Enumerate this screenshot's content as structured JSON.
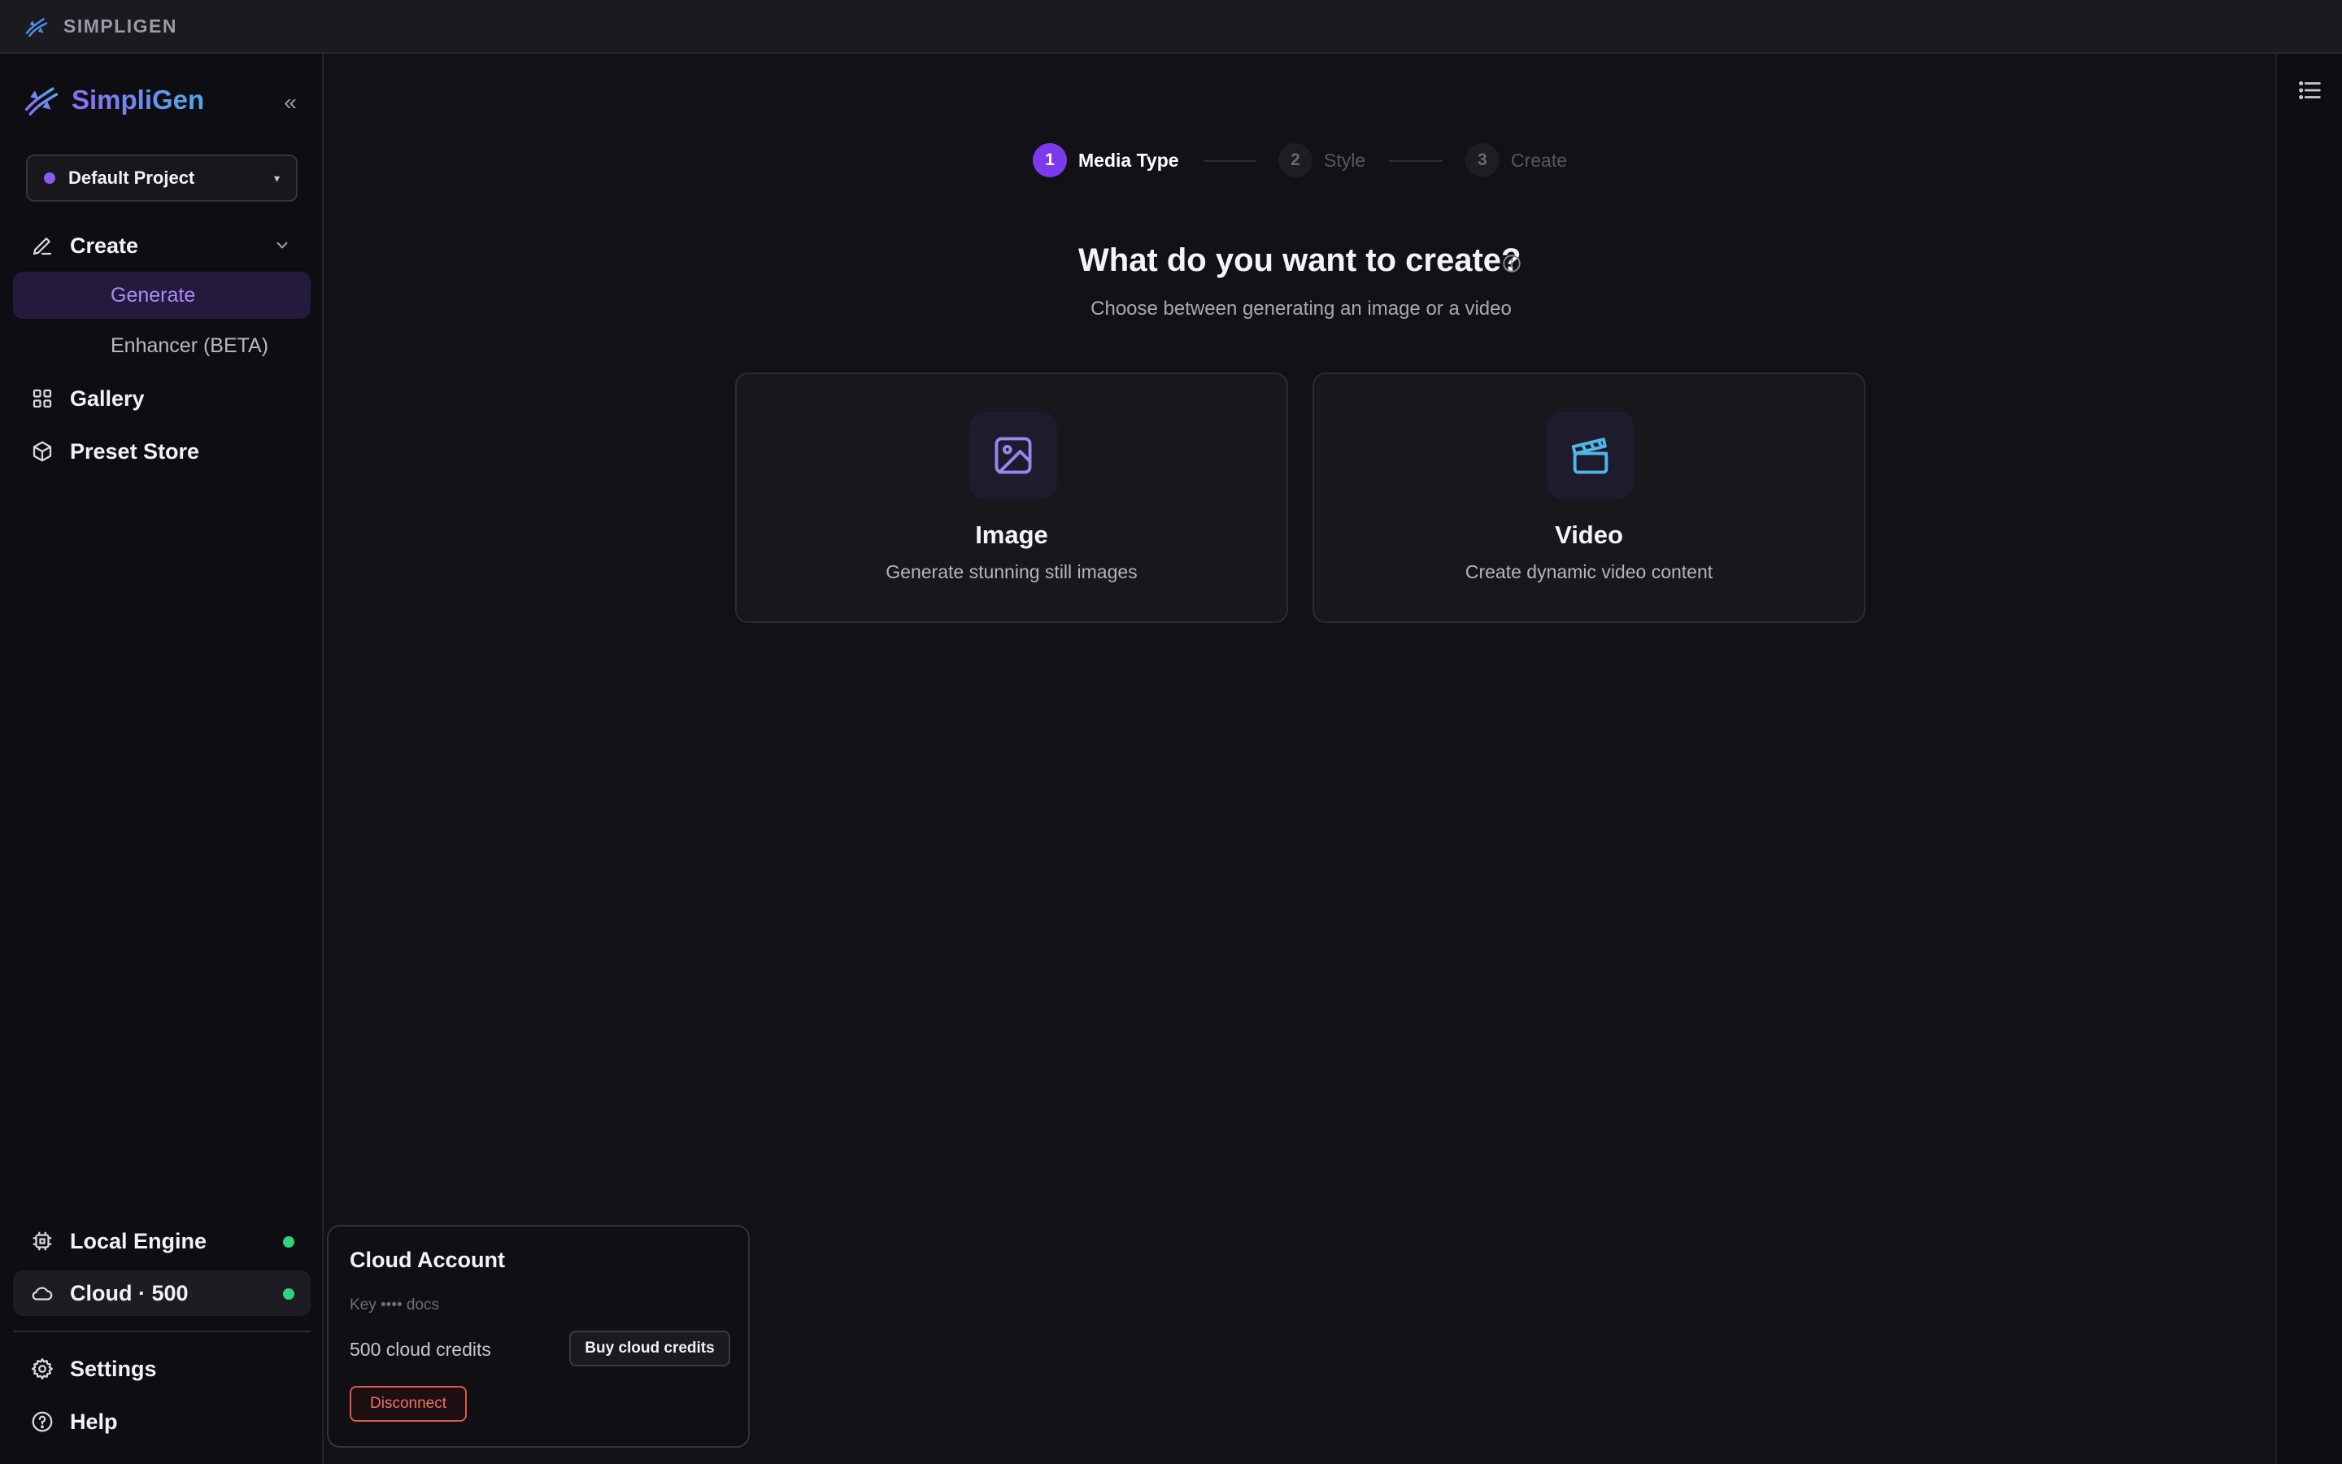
{
  "titlebar": {
    "app_name": "SIMPLIGEN"
  },
  "sidebar": {
    "brand": "SimpliGen",
    "collapse_glyph": "«",
    "project": {
      "label": "Default Project",
      "caret": "▾"
    },
    "create": {
      "label": "Create"
    },
    "sub_items": [
      {
        "label": "Generate",
        "active": true
      },
      {
        "label": "Enhancer (BETA)",
        "active": false
      }
    ],
    "gallery": {
      "label": "Gallery"
    },
    "preset_store": {
      "label": "Preset Store"
    },
    "local_engine": {
      "label": "Local Engine",
      "status": "online"
    },
    "cloud": {
      "label": "Cloud · 500",
      "status": "online"
    },
    "settings": {
      "label": "Settings"
    },
    "help": {
      "label": "Help"
    }
  },
  "stepper": {
    "steps": [
      {
        "num": "1",
        "label": "Media Type",
        "state": "active"
      },
      {
        "num": "2",
        "label": "Style",
        "state": "inactive"
      },
      {
        "num": "3",
        "label": "Create",
        "state": "inactive"
      }
    ]
  },
  "main": {
    "title": "What do you want to create?",
    "subtitle": "Choose between generating an image or a video",
    "cards": [
      {
        "title": "Image",
        "description": "Generate stunning still images",
        "icon": "image-icon"
      },
      {
        "title": "Video",
        "description": "Create dynamic video content",
        "icon": "clapperboard-icon"
      }
    ]
  },
  "cloud_popover": {
    "title": "Cloud Account",
    "key_text": "Key •••• docs",
    "credits_text": "500 cloud credits",
    "buy_label": "Buy cloud credits",
    "disconnect_label": "Disconnect"
  },
  "colors": {
    "accent": "#7c3aed",
    "status_online": "#2fd27d",
    "danger": "#e0584a"
  }
}
